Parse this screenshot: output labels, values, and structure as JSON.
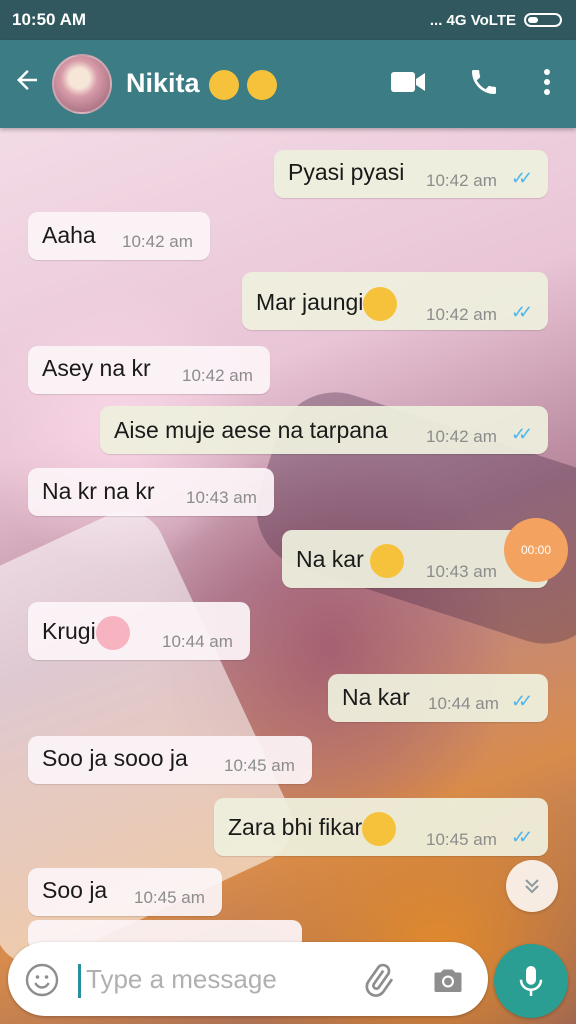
{
  "status_bar": {
    "time": "10:50 AM",
    "signal_text": "... 4G VoLTE"
  },
  "header": {
    "contact_name": "Nikita",
    "emojis": [
      "kissing-face",
      "heart-eyes-face"
    ]
  },
  "messages": [
    {
      "dir": "out",
      "text": "Pyasi pyasi",
      "time": "10:42 am",
      "read": true
    },
    {
      "dir": "in",
      "text": "Aaha",
      "time": "10:42 am"
    },
    {
      "dir": "out",
      "text": "Mar jaungi",
      "emoji": "frowning-face",
      "time": "10:42 am",
      "read": true
    },
    {
      "dir": "in",
      "text": "Asey na kr",
      "time": "10:42 am"
    },
    {
      "dir": "out",
      "text": "Aise muje aese na tarpana",
      "time": "10:42 am",
      "read": true
    },
    {
      "dir": "in",
      "text": "Na kr na kr",
      "time": "10:43 am"
    },
    {
      "dir": "out",
      "text": "Na kar",
      "emoji": "crying-face",
      "time": "10:43 am",
      "read": true
    },
    {
      "dir": "in",
      "text": "Krugi",
      "emoji": "pig-face",
      "time": "10:44 am"
    },
    {
      "dir": "out",
      "text": "Na kar",
      "time": "10:44 am",
      "read": true
    },
    {
      "dir": "in",
      "text": "Soo ja sooo ja",
      "time": "10:45 am"
    },
    {
      "dir": "out",
      "text": "Zara bhi fikar",
      "emoji": "heart-eyes-face",
      "time": "10:45 am",
      "read": true
    },
    {
      "dir": "in",
      "text": "Soo ja",
      "time": "10:45 am"
    }
  ],
  "overlay_badge": "00:00",
  "composer": {
    "placeholder": "Type a message"
  },
  "colors": {
    "status_bar": "#30585e",
    "app_bar": "#3c7c84",
    "mic_button": "#2b9e93",
    "tick": "#4fb6ec"
  }
}
